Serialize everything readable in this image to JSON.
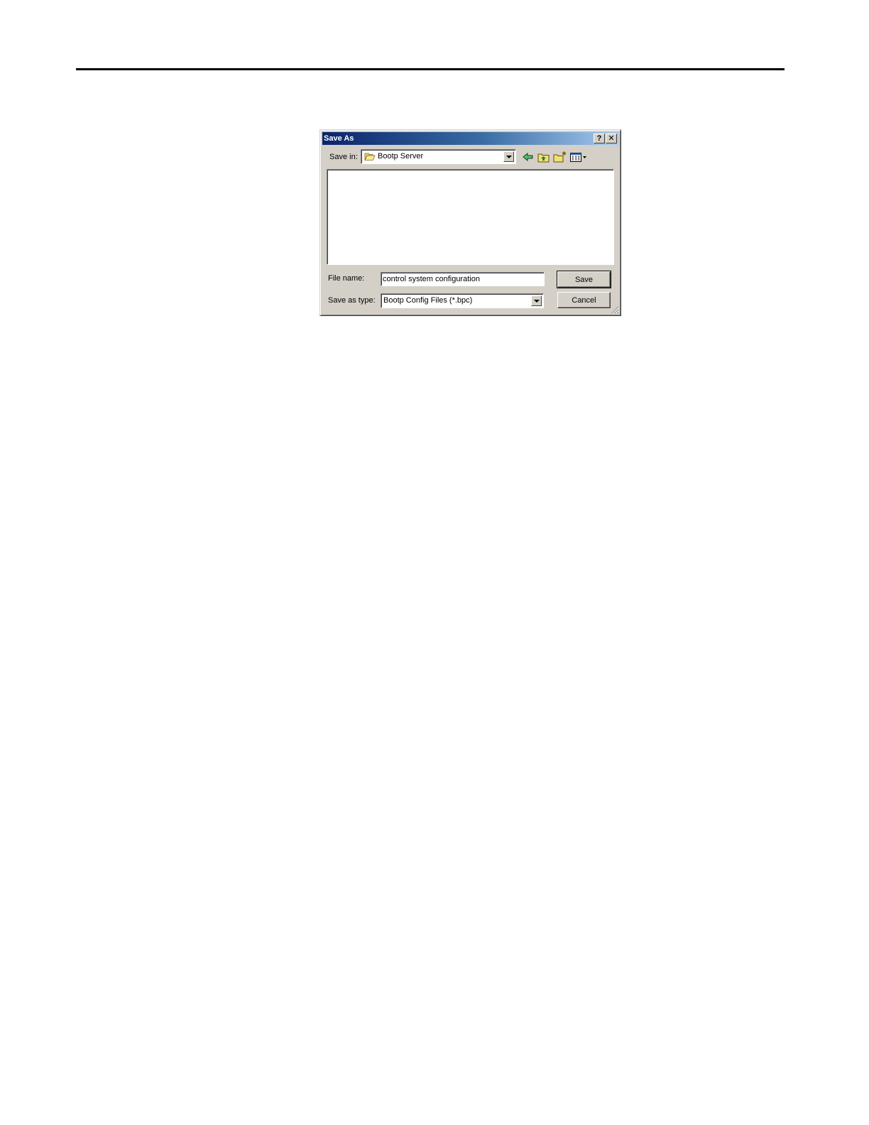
{
  "dialog": {
    "title": "Save As",
    "help_button": "?",
    "close_button": "✕",
    "save_in": {
      "label": "Save in:",
      "value": "Bootp Server"
    },
    "toolbar": {
      "icons": [
        "back-arrow-icon",
        "up-one-level-icon",
        "new-folder-icon",
        "view-menu-icon"
      ]
    },
    "file_name": {
      "label": "File name:",
      "value": "control system configuration"
    },
    "save_as_type": {
      "label": "Save as type:",
      "value": "Bootp Config Files (*.bpc)"
    },
    "buttons": {
      "save": "Save",
      "cancel": "Cancel"
    }
  },
  "colors": {
    "title_gradient_start": "#0a246a",
    "title_gradient_end": "#a6caf0",
    "dialog_face": "#d4d0c8"
  }
}
